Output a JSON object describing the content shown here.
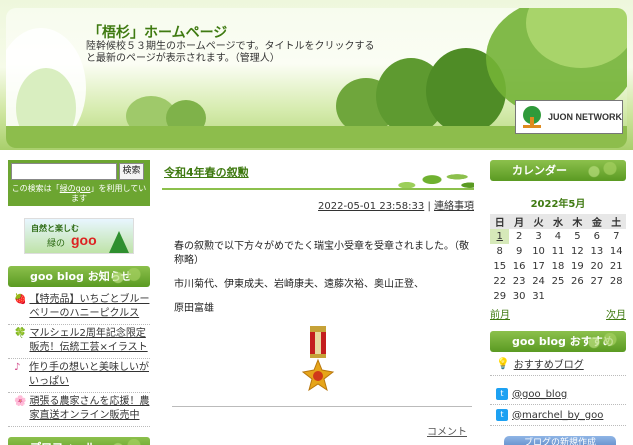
{
  "header": {
    "title": "「梧杉」ホームページ",
    "description": "陸幹候校５３期生のホームページです。タイトルをクリックすると最新のページが表示されます。（管理人）",
    "network_label": "JUON NETWORK"
  },
  "search": {
    "button_label": "検索",
    "note_prefix": "この検索は「",
    "note_link": "緑のgoo",
    "note_suffix": "」を利用しています"
  },
  "banner": {
    "line1": "自然と楽しむ",
    "line2": "緑の",
    "brand": "goo"
  },
  "sidebar_left": {
    "news_title": "goo blog お知らせ",
    "news": [
      {
        "icon": "🍓",
        "text": "【特売品】いちごとブルーベリーのハニーピクルス"
      },
      {
        "icon": "🍀",
        "text": "マルシェル2周年記念限定販売！伝統工芸×イラスト"
      },
      {
        "icon": "♪",
        "text": "作り手の想いと美味しいがいっぱい"
      },
      {
        "icon": "🌸",
        "text": "頑張る農家さんを応援！農家直送オンライン販売中"
      }
    ],
    "profile_title": "プロフィール"
  },
  "post": {
    "title": "令和4年春の叙勲",
    "datetime": "2022-05-01 23:58:33",
    "separator": "|",
    "category": "連絡事項",
    "paragraphs": [
      "春の叙勲で以下方々がめでたく瑞宝小受章を受章されました。（敬称略）",
      "市川菊代、伊東成夫、岩崎康夫、遠藤次裕、奥山正登、",
      "原田富雄"
    ],
    "comment_label": "コメント"
  },
  "calendar": {
    "header": "カレンダー",
    "month": "2022年5月",
    "weekdays": [
      "日",
      "月",
      "火",
      "水",
      "木",
      "金",
      "土"
    ],
    "weeks": [
      [
        "1",
        "2",
        "3",
        "4",
        "5",
        "6",
        "7"
      ],
      [
        "8",
        "9",
        "10",
        "11",
        "12",
        "13",
        "14"
      ],
      [
        "15",
        "16",
        "17",
        "18",
        "19",
        "20",
        "21"
      ],
      [
        "22",
        "23",
        "24",
        "25",
        "26",
        "27",
        "28"
      ],
      [
        "29",
        "30",
        "31",
        "",
        "",
        "",
        ""
      ]
    ],
    "prev_label": "前月",
    "next_label": "次月"
  },
  "recommend": {
    "title": "goo blog おすすめ",
    "items": [
      {
        "icon": "bulb-icon",
        "text": "おすすめブログ"
      },
      {
        "icon": "twitter-icon",
        "text": "@goo_blog"
      },
      {
        "icon": "twitter-icon",
        "text": "@marchel_by_goo"
      }
    ],
    "bottom_button": "ブログの新規作成"
  }
}
